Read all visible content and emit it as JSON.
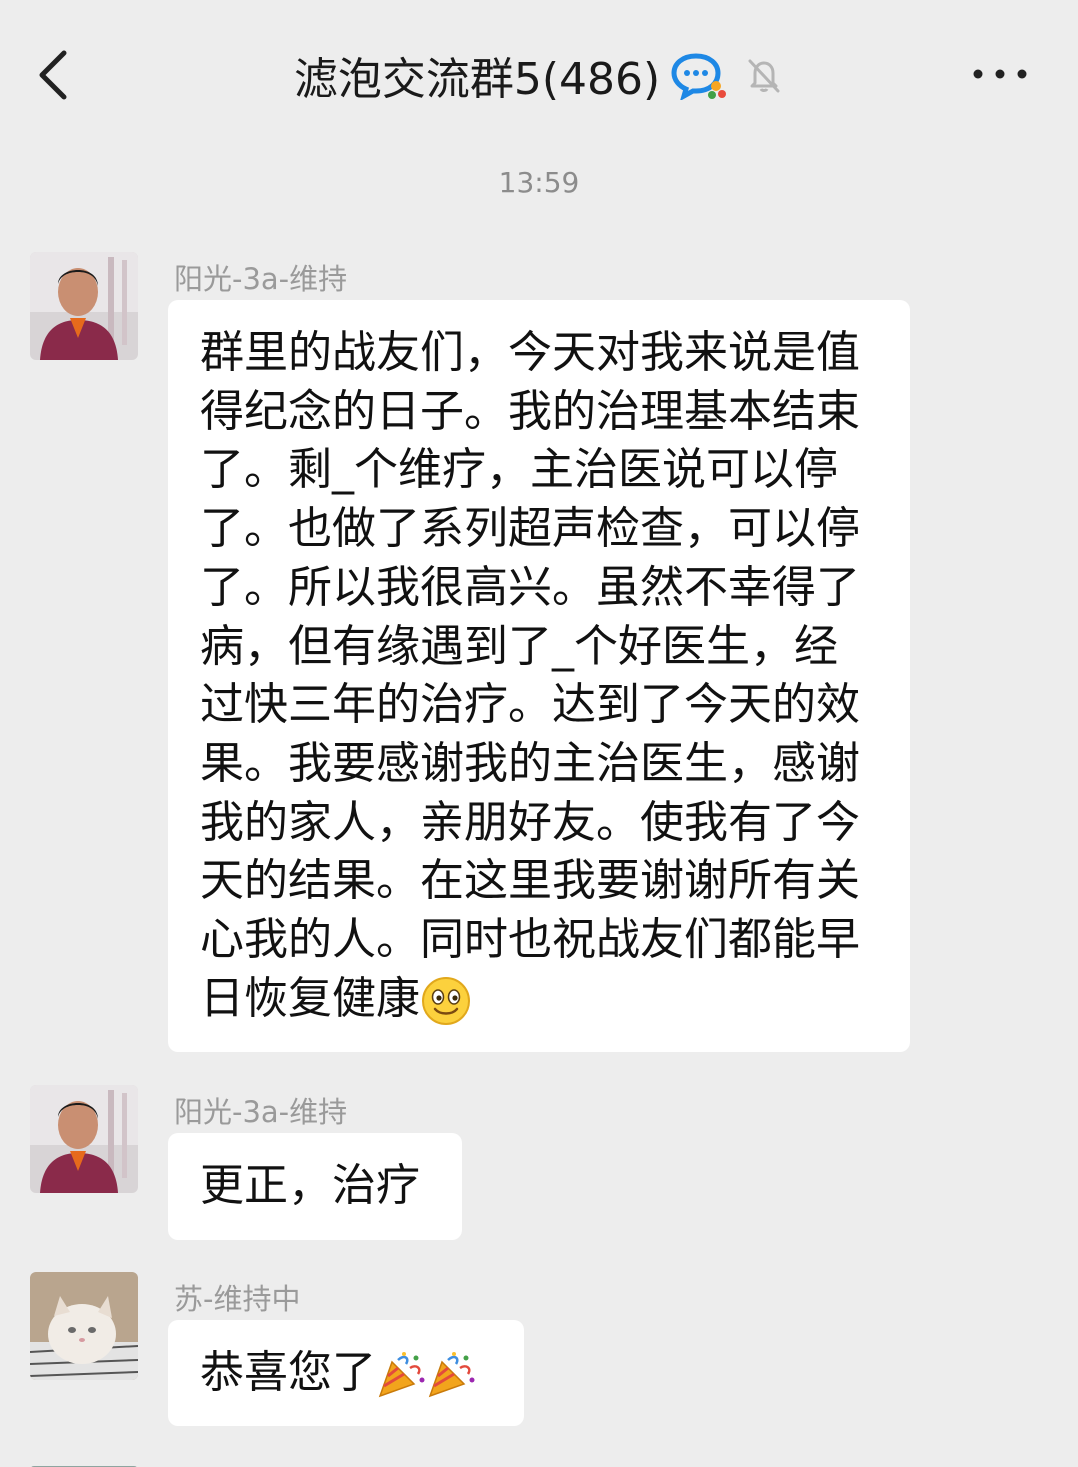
{
  "header": {
    "title": "滤泡交流群5(486)",
    "back_icon": "chevron-left-icon",
    "group_icon": "group-chat-icon",
    "mute_icon": "bell-muted-icon",
    "more_icon": "more-dots-icon"
  },
  "timestamp": "13:59",
  "messages": [
    {
      "sender": "阳光-3a-维持",
      "lines": [
        "群里的战友们，今天对我来说是值",
        "得纪念的日子。我的治理基本结束",
        "了。剩_个维疗，主治医说可以停",
        "了。也做了系列超声检查，可以停",
        "了。所以我很高兴。虽然不幸得了",
        "病，但有缘遇到了_个好医生，经",
        "过快三年的治疗。达到了今天的效",
        "果。我要感谢我的主治医生，感谢",
        "我的家人，亲朋好友。使我有了今",
        "天的结果。在这里我要谢谢所有关",
        "心我的人。同时也祝战友们都能早",
        "日恢复健康"
      ],
      "trailing_emoji": "smile-emoji"
    },
    {
      "sender": "阳光-3a-维持",
      "text": "更正，治疗"
    },
    {
      "sender": "苏-维持中",
      "text": "恭喜您了",
      "trailing_emoji": "party-popper-emoji"
    }
  ]
}
